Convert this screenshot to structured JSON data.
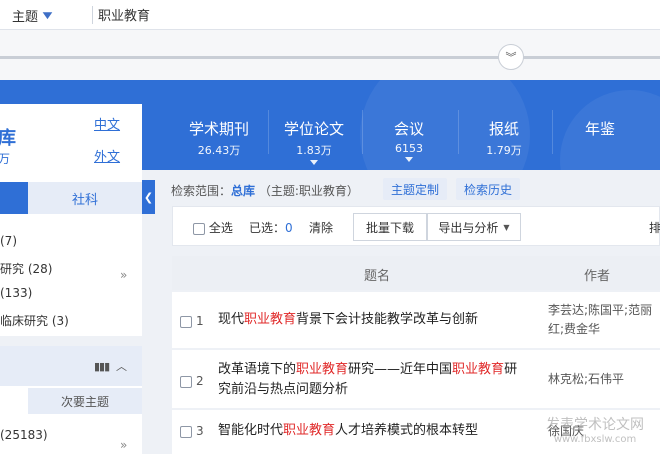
{
  "search": {
    "field_label": "主题",
    "query": "职业教育"
  },
  "banner": {
    "tabs": [
      {
        "label": "学术期刊",
        "count": "26.43万"
      },
      {
        "label": "学位论文",
        "count": "1.83万"
      },
      {
        "label": "会议",
        "count": "6153"
      },
      {
        "label": "报纸",
        "count": "1.79万"
      },
      {
        "label": "年鉴",
        "count": ""
      }
    ]
  },
  "library": {
    "title": "库",
    "count": "万",
    "lang_cn": "中文",
    "lang_foreign": "外文",
    "tab_social": "社科",
    "facets": [
      "(7)",
      "研究 (28)",
      "(133)",
      "临床研究 (3)"
    ],
    "section2_button": "次要主题",
    "section2_facets": [
      "(25183)"
    ]
  },
  "scope": {
    "prefix": "检索范围：",
    "library": "总库",
    "condition": "（主题:职业教育）",
    "custom_button": "主题定制",
    "history_button": "检索历史"
  },
  "toolbar": {
    "select_all": "全选",
    "selected_label": "已选：",
    "selected_count": "0",
    "clear": "清除",
    "batch_download": "批量下载",
    "export_analyze": "导出与分析",
    "sort_cut": "排"
  },
  "table": {
    "col_title": "题名",
    "col_author": "作者",
    "rows": [
      {
        "num": "1",
        "pre": "现代",
        "hl": "职业教育",
        "post": "背景下会计技能教学改革与创新",
        "hl2": "",
        "post2": "",
        "authors": "李芸达;陈国平;范丽红;费金华"
      },
      {
        "num": "2",
        "pre": "改革语境下的",
        "hl": "职业教育",
        "post": "研究——近年中国",
        "hl2": "职业教育",
        "post2": "研究前沿与热点问题分析",
        "authors": "林克松;石伟平"
      },
      {
        "num": "3",
        "pre": "智能化时代",
        "hl": "职业教育",
        "post": "人才培养模式的根本转型",
        "hl2": "",
        "post2": "",
        "authors": "徐国庆"
      }
    ]
  },
  "watermark": {
    "line1": "发表学术论文网",
    "line2": "www.fbxslw.com"
  },
  "colors": {
    "brand_blue": "#2f6fd6",
    "highlight_red": "#e02828"
  }
}
